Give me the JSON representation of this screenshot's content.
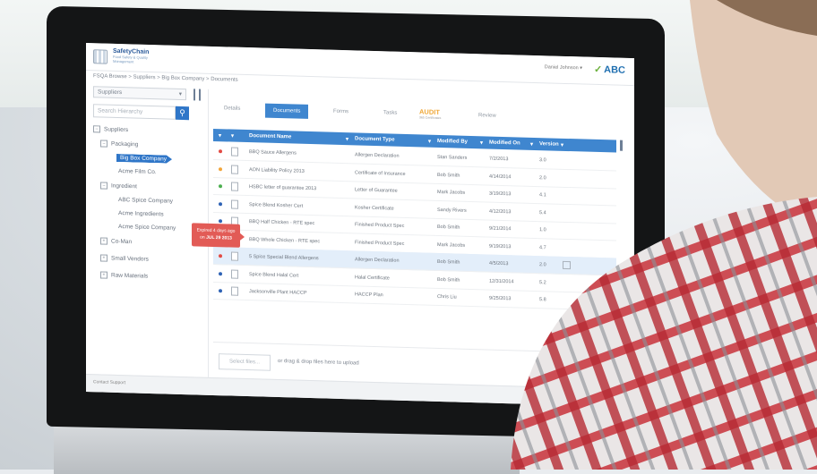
{
  "app": {
    "logo_text": "SafetyChain",
    "logo_sub": "Food Safety & Quality Management",
    "user": "Daniel Johnson",
    "company_logo": "ABC",
    "breadcrumb": "FSQA Browse > Suppliers > Big Box Company > Documents"
  },
  "left": {
    "select_value": "Suppliers",
    "search_placeholder": "Search Hierarchy",
    "tree": {
      "suppliers": "Suppliers",
      "packaging": "Packaging",
      "big_box": "Big Box Company",
      "acme_film": "Acme Film Co.",
      "ingredient": "Ingredient",
      "abc_spice": "ABC Spice Company",
      "acme_ingredients": "Acme Ingredients",
      "acme_spice": "Acme Spice Company",
      "co_man": "Co-Man",
      "small_vendors": "Small Vendors",
      "raw_materials": "Raw Materials"
    }
  },
  "tooltip": {
    "line1": "Expired 4 days ago",
    "line2_prefix": "on",
    "line2_date": "JUL 29 2013"
  },
  "tabs": {
    "details": "Details",
    "documents": "Documents",
    "forms": "Forms",
    "tasks": "Tasks",
    "audit": "AUDIT",
    "audit_sub": "365 Certificates",
    "review": "Review"
  },
  "table": {
    "headers": {
      "name": "Document Name",
      "type": "Document Type",
      "modified_by": "Modified By",
      "modified_on": "Modified On",
      "version": "Version"
    },
    "rows": [
      {
        "name": "BBQ Sauce Allergens",
        "type": "Allergen Declaration",
        "by": "Stan Sanders",
        "on": "7/2/2013",
        "ver": "3.0"
      },
      {
        "name": "AON Liability Policy 2013",
        "type": "Certificate of Insurance",
        "by": "Bob Smith",
        "on": "4/14/2014",
        "ver": "2.0"
      },
      {
        "name": "HSBC letter of guarantee 2013",
        "type": "Letter of Guarantee",
        "by": "Mark Jacobs",
        "on": "3/19/2013",
        "ver": "4.1"
      },
      {
        "name": "Spice Blend Kosher Cert",
        "type": "Kosher Certificate",
        "by": "Sandy Rivers",
        "on": "4/12/2013",
        "ver": "5.4"
      },
      {
        "name": "BBQ Half Chicken - RTE spec",
        "type": "Finished Product Spec",
        "by": "Bob Smith",
        "on": "9/21/2014",
        "ver": "1.0"
      },
      {
        "name": "BBQ Whole Chicken - RTE spec",
        "type": "Finished Product Spec",
        "by": "Mark Jacobs",
        "on": "9/19/2013",
        "ver": "4.7"
      },
      {
        "name": "5 Spice Special Blend Allergens",
        "type": "Allergen Declaration",
        "by": "Bob Smith",
        "on": "4/5/2013",
        "ver": "2.0"
      },
      {
        "name": "Spice Blend Halal Cert",
        "type": "Halal Certificate",
        "by": "Bob Smith",
        "on": "12/31/2014",
        "ver": "5.2"
      },
      {
        "name": "Jacksonville Plant HACCP",
        "type": "HACCP Plan",
        "by": "Chris Liu",
        "on": "9/25/2013",
        "ver": "5.8"
      }
    ],
    "status_colors": [
      "#e24b44",
      "#f2a53a",
      "#4caf50",
      "#2f63b5",
      "#2f63b5",
      "#2f63b5",
      "#e24b44",
      "#2f63b5",
      "#2f63b5"
    ]
  },
  "upload": {
    "button": "Select files...",
    "text": "or drag & drop files here to upload"
  },
  "footer": {
    "support": "Contact Support"
  }
}
